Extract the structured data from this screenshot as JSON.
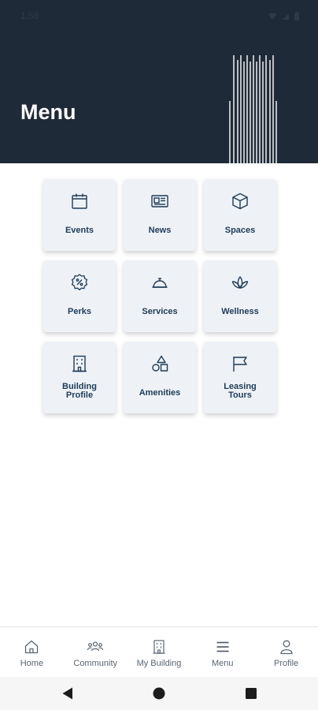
{
  "status_bar": {
    "time": "1:58",
    "icons": [
      "wifi-icon",
      "signal-icon",
      "battery-icon"
    ]
  },
  "header": {
    "title": "Menu",
    "background_color": "#1f2a38",
    "art_icon": "building-lines-art"
  },
  "menu": {
    "tile_background": "#eef2f6",
    "label_color": "#1f3b58",
    "items": [
      {
        "label": "Events",
        "icon": "calendar-icon"
      },
      {
        "label": "News",
        "icon": "newspaper-icon"
      },
      {
        "label": "Spaces",
        "icon": "cube-icon"
      },
      {
        "label": "Perks",
        "icon": "discount-badge-icon"
      },
      {
        "label": "Services",
        "icon": "service-bell-icon"
      },
      {
        "label": "Wellness",
        "icon": "lotus-icon"
      },
      {
        "label": "Building\nProfile",
        "icon": "building-icon"
      },
      {
        "label": "Amenities",
        "icon": "shapes-icon"
      },
      {
        "label": "Leasing\nTours",
        "icon": "flag-icon"
      }
    ]
  },
  "bottom_nav": {
    "items": [
      {
        "label": "Home",
        "icon": "home-icon"
      },
      {
        "label": "Community",
        "icon": "community-icon"
      },
      {
        "label": "My Building",
        "icon": "building-icon"
      },
      {
        "label": "Menu",
        "icon": "hamburger-icon"
      },
      {
        "label": "Profile",
        "icon": "person-icon"
      }
    ]
  },
  "system_nav": {
    "buttons": [
      "back-icon",
      "home-circle-icon",
      "recents-square-icon"
    ]
  }
}
